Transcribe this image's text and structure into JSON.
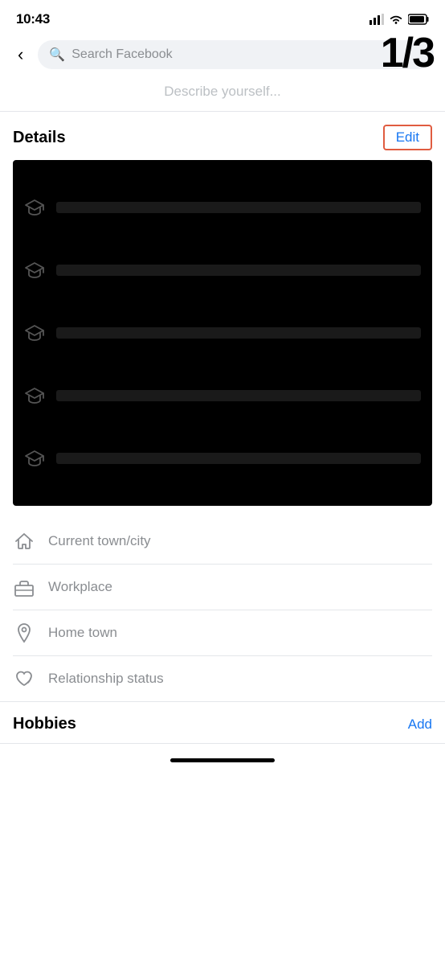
{
  "statusBar": {
    "time": "10:43"
  },
  "header": {
    "backLabel": "‹",
    "searchPlaceholder": "Search Facebook",
    "pageCounter": "1/3"
  },
  "describe": {
    "placeholder": "Describe yourself..."
  },
  "details": {
    "title": "Details",
    "editLabel": "Edit",
    "educationItems": [
      {
        "id": "edu1"
      },
      {
        "id": "edu2"
      },
      {
        "id": "edu3"
      },
      {
        "id": "edu4"
      },
      {
        "id": "edu5"
      }
    ],
    "listItems": [
      {
        "icon": "home",
        "label": "Current town/city"
      },
      {
        "icon": "work",
        "label": "Workplace"
      },
      {
        "icon": "location",
        "label": "Home town"
      },
      {
        "icon": "relationship",
        "label": "Relationship status"
      }
    ]
  },
  "hobbies": {
    "title": "Hobbies",
    "addLabel": "Add"
  }
}
